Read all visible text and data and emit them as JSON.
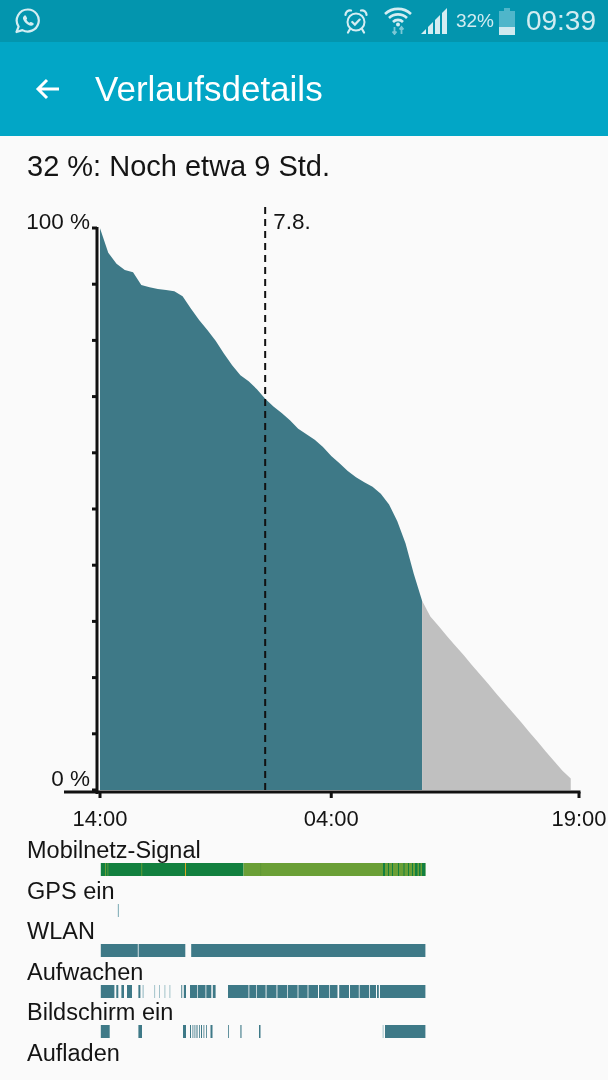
{
  "status_bar": {
    "battery_text": "32%",
    "time": "09:39"
  },
  "app_bar": {
    "title": "Verlaufsdetails"
  },
  "summary": "32 %: Noch etwa 9 Std.",
  "chart": {
    "chart_data": {
      "type": "area",
      "categories": [
        "14:00",
        null,
        null,
        null,
        null,
        null,
        null,
        null,
        null,
        null,
        null,
        null,
        null,
        null,
        null,
        null,
        null,
        null,
        null,
        null,
        null,
        null,
        null,
        null,
        null,
        null,
        null,
        null,
        "04:00",
        null,
        null,
        null,
        null,
        null,
        null,
        null,
        null,
        null,
        null,
        null,
        null,
        null,
        null,
        null,
        null,
        null,
        null,
        null,
        null,
        null,
        null,
        null,
        null,
        null,
        null,
        null,
        null,
        null,
        "19:00"
      ],
      "series": [
        {
          "color": "#3e7987",
          "values": [
            98.8,
            94.4,
            92.4,
            91.3,
            90.9,
            88.6,
            88.2,
            87.9,
            87.7,
            87.5,
            86.6,
            84.4,
            82.3,
            80.5,
            78.6,
            76.3,
            74.2,
            72.4,
            71.3,
            69.9,
            68.2,
            66.8,
            65.6,
            64.3,
            62.8,
            61.8,
            60.8,
            59.5,
            57.9,
            56.6,
            55.2,
            54.1,
            53.2,
            52.4,
            51.1,
            49.2,
            46.2,
            42.2,
            36.7,
            31.9,
            null,
            null,
            null,
            null,
            null,
            null,
            null,
            null,
            null,
            null,
            null,
            null,
            null,
            null,
            null,
            null,
            null,
            null,
            null
          ]
        },
        {
          "color": "#c0c0c0",
          "values": [
            null,
            null,
            null,
            null,
            null,
            null,
            null,
            null,
            null,
            null,
            null,
            null,
            null,
            null,
            null,
            null,
            null,
            null,
            null,
            null,
            null,
            null,
            null,
            null,
            null,
            null,
            null,
            null,
            null,
            null,
            null,
            null,
            null,
            null,
            null,
            null,
            null,
            null,
            null,
            31.9,
            29.1,
            27.4,
            25.6,
            23.9,
            22.2,
            20.4,
            18.7,
            17,
            15.2,
            13.5,
            11.8,
            10.1,
            8.3,
            6.6,
            4.8,
            3.1,
            1.4,
            0,
            null
          ]
        }
      ],
      "ylim": [
        0,
        100
      ],
      "yticks": [
        {
          "value": 0,
          "label": "0 %"
        },
        {
          "value": 100,
          "label": "100 %"
        }
      ],
      "annotations": [
        "7.8."
      ]
    }
  },
  "activity_rows": [
    {
      "label": "Mobilnetz-Signal"
    },
    {
      "label": "GPS ein"
    },
    {
      "label": "WLAN"
    },
    {
      "label": "Aufwachen"
    },
    {
      "label": "Bildschirm ein"
    },
    {
      "label": "Aufladen"
    }
  ]
}
